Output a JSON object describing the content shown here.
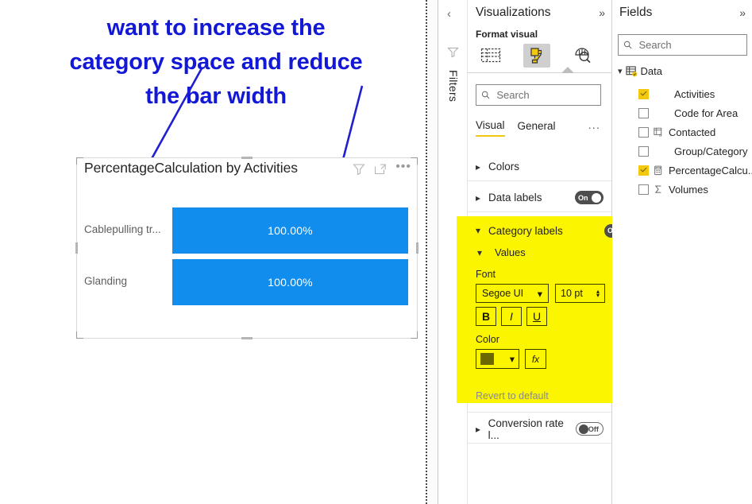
{
  "annotation": {
    "text": "want to increase the\ncategory space and reduce\nthe bar width",
    "color": "#1218d6"
  },
  "visual": {
    "title": "PercentageCalculation by Activities",
    "icons": {
      "filter": "filter-icon",
      "focus": "focus-mode-icon",
      "more": "more-options-icon"
    }
  },
  "chart_data": {
    "type": "bar",
    "title": "PercentageCalculation by Activities",
    "orientation": "horizontal",
    "categories": [
      "Cablepulling tr...",
      "Glanding"
    ],
    "values": [
      100.0,
      100.0
    ],
    "data_labels": [
      "100.00%",
      "100.00%"
    ],
    "series": [
      {
        "name": "PercentageCalculation",
        "values": [
          100.0,
          100.0
        ],
        "color": "#118DEE"
      }
    ],
    "xlabel": "",
    "ylabel": "",
    "xlim": [
      0,
      100
    ],
    "grid": false,
    "legend": "none"
  },
  "visualizations": {
    "rail_label": "Filters",
    "title": "Visualizations",
    "expand_icon": "chevron-double-right-icon",
    "collapse_icon": "chevron-left-icon",
    "format_visual_label": "Format visual",
    "icon_buttons": [
      {
        "name": "build-visual-icon",
        "active": false
      },
      {
        "name": "format-visual-icon",
        "active": true
      },
      {
        "name": "analytics-icon",
        "active": false
      }
    ],
    "search_placeholder": "Search",
    "search_value": "",
    "tabs": [
      {
        "label": "Visual",
        "active": true
      },
      {
        "label": "General",
        "active": false
      }
    ],
    "tabs_overflow": "...",
    "sections": [
      {
        "label": "Colors",
        "expanded": false,
        "toggle": null
      },
      {
        "label": "Data labels",
        "expanded": false,
        "toggle": "On"
      },
      {
        "label": "Category labels",
        "expanded": true,
        "toggle": "On",
        "highlighted": true
      },
      {
        "label": "Conversion rate l...",
        "expanded": false,
        "toggle": "Off"
      }
    ],
    "category_labels": {
      "header": "Category labels",
      "toggle": "On",
      "values_group": "Values",
      "font_label": "Font",
      "font_family": "Segoe UI",
      "font_size": "10  pt",
      "bold": "B",
      "italic": "I",
      "underline": "U",
      "color_label": "Color",
      "color_value": "#000000",
      "fx_label": "fx"
    },
    "revert_label": "Revert to default",
    "highlight_color": "#FCF500"
  },
  "fields": {
    "title": "Fields",
    "expand_icon": "chevron-double-right-icon",
    "search_placeholder": "Search",
    "search_value": "",
    "table": {
      "label": "Data",
      "expanded": true,
      "icon": "table-icon"
    },
    "items": [
      {
        "label": "Activities",
        "checked": true,
        "icon": null
      },
      {
        "label": "Code for Area",
        "checked": false,
        "icon": null
      },
      {
        "label": "Contacted",
        "checked": false,
        "icon": "calculated-table-icon"
      },
      {
        "label": "Group/Category",
        "checked": false,
        "icon": null
      },
      {
        "label": "PercentageCalcu...",
        "checked": true,
        "icon": "measure-icon"
      },
      {
        "label": "Volumes",
        "checked": false,
        "icon": "sigma-icon"
      }
    ]
  }
}
